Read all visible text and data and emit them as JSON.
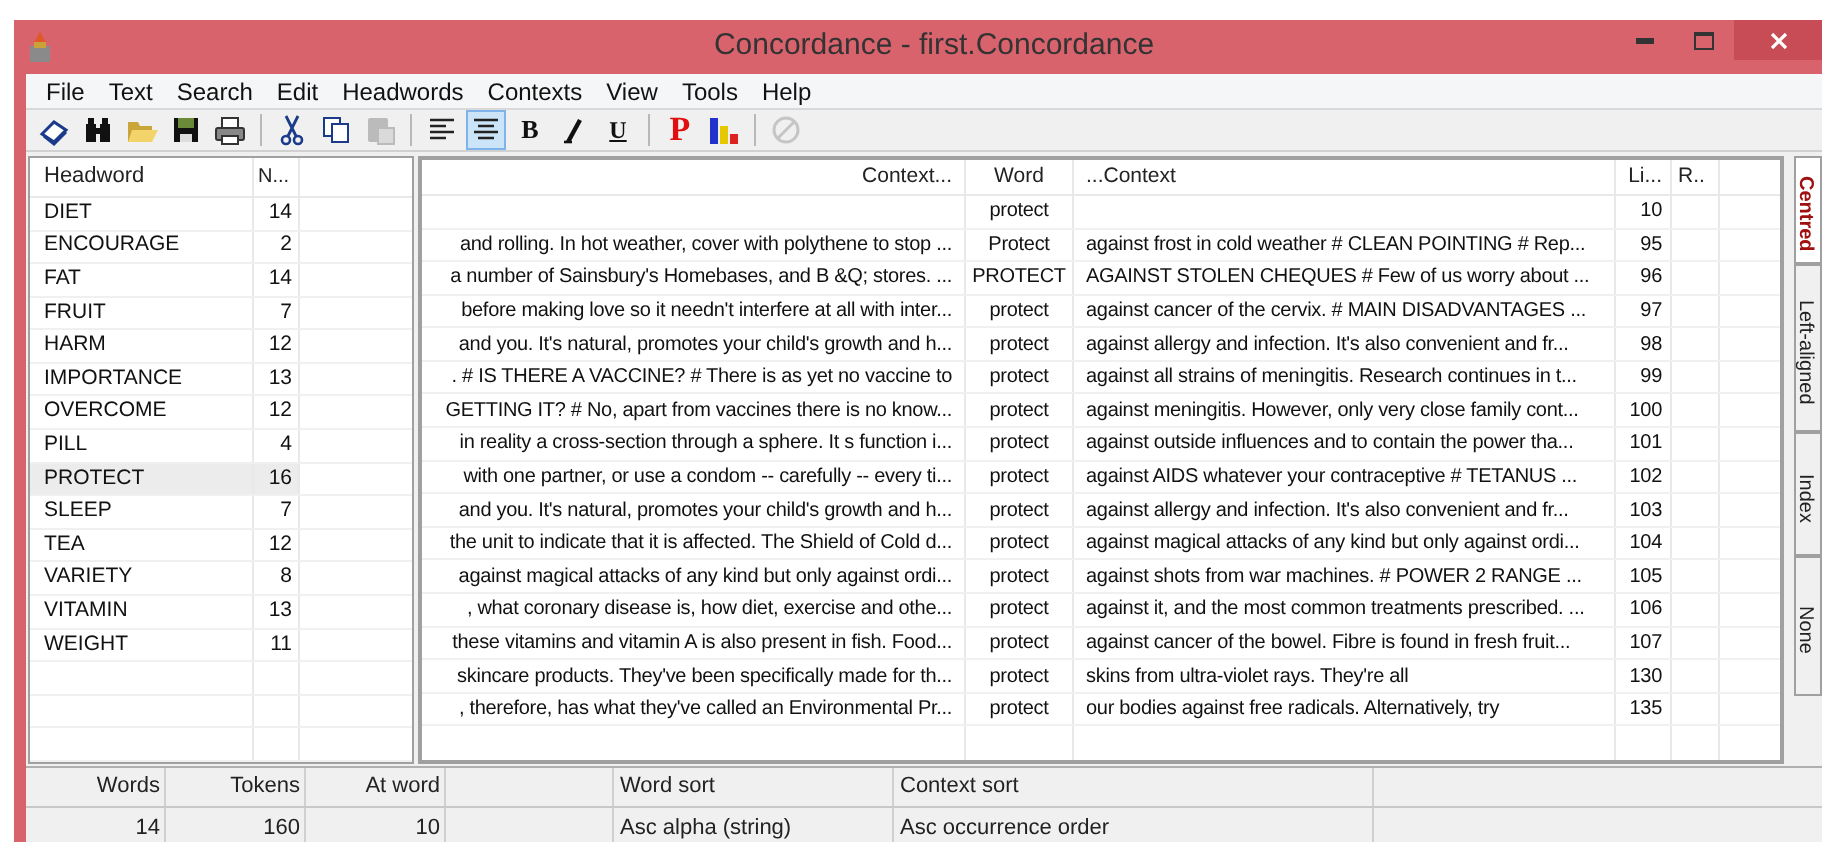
{
  "window": {
    "title": "Concordance - first.Concordance"
  },
  "menu": [
    "File",
    "Text",
    "Search",
    "Edit",
    "Headwords",
    "Contexts",
    "View",
    "Tools",
    "Help"
  ],
  "toolbar": [
    {
      "kind": "icon",
      "selected": false,
      "disabled": false
    },
    {
      "kind": "icon",
      "selected": false,
      "disabled": false
    },
    {
      "kind": "icon",
      "selected": false,
      "disabled": false
    },
    {
      "kind": "icon",
      "selected": false,
      "disabled": false
    },
    {
      "kind": "icon",
      "selected": false,
      "disabled": false
    },
    {
      "kind": "separator"
    },
    {
      "kind": "icon",
      "selected": false,
      "disabled": false
    },
    {
      "kind": "icon",
      "selected": false,
      "disabled": false
    },
    {
      "kind": "icon",
      "selected": false,
      "disabled": true
    },
    {
      "kind": "separator"
    },
    {
      "kind": "icon",
      "selected": false,
      "disabled": false
    },
    {
      "kind": "icon",
      "selected": true,
      "disabled": false
    },
    {
      "kind": "letter",
      "label": "B",
      "selected": false
    },
    {
      "kind": "icon",
      "selected": false,
      "disabled": false
    },
    {
      "kind": "letter",
      "label": "U",
      "selected": false
    },
    {
      "kind": "separator"
    },
    {
      "kind": "letter",
      "label": "P",
      "selected": false
    },
    {
      "kind": "icon",
      "selected": false,
      "disabled": false
    },
    {
      "kind": "separator"
    },
    {
      "kind": "icon",
      "selected": false,
      "disabled": true
    }
  ],
  "headwords": {
    "columns": [
      "Headword",
      "N..."
    ],
    "rows": [
      {
        "word": "DIET",
        "count": "14",
        "selected": false
      },
      {
        "word": "ENCOURAGE",
        "count": "2",
        "selected": false
      },
      {
        "word": "FAT",
        "count": "14",
        "selected": false
      },
      {
        "word": "FRUIT",
        "count": "7",
        "selected": false
      },
      {
        "word": "HARM",
        "count": "12",
        "selected": false
      },
      {
        "word": "IMPORTANCE",
        "count": "13",
        "selected": false
      },
      {
        "word": "OVERCOME",
        "count": "12",
        "selected": false
      },
      {
        "word": "PILL",
        "count": "4",
        "selected": false
      },
      {
        "word": "PROTECT",
        "count": "16",
        "selected": true
      },
      {
        "word": "SLEEP",
        "count": "7",
        "selected": false
      },
      {
        "word": "TEA",
        "count": "12",
        "selected": false
      },
      {
        "word": "VARIETY",
        "count": "8",
        "selected": false
      },
      {
        "word": "VITAMIN",
        "count": "13",
        "selected": false
      },
      {
        "word": "WEIGHT",
        "count": "11",
        "selected": false
      }
    ]
  },
  "contexts": {
    "columns": [
      "Context...",
      "Word",
      "...Context",
      "Li...",
      "R.."
    ],
    "rows": [
      {
        "left": "",
        "word": "protect",
        "right": "",
        "line": "10"
      },
      {
        "left": "and rolling. In hot weather, cover with polythene to stop ...",
        "word": "Protect",
        "right": "against frost in cold weather # CLEAN POINTING # Rep...",
        "line": "95"
      },
      {
        "left": "a number of Sainsbury's Homebases, and B &Q; stores. ...",
        "word": "PROTECT",
        "right": "AGAINST STOLEN CHEQUES # Few of us worry about ...",
        "line": "96"
      },
      {
        "left": " before making love so it needn't interfere at all with inter...",
        "word": "protect",
        "right": "against cancer of the cervix. # MAIN DISADVANTAGES ...",
        "line": "97"
      },
      {
        "left": "and you. It's natural, promotes your child's growth and h...",
        "word": "protect",
        "right": "against allergy and infection. It's also convenient and fr...",
        "line": "98"
      },
      {
        "left": " . # IS THERE A VACCINE? # There is as yet no vaccine to",
        "word": "protect",
        "right": "against all strains of meningitis. Research continues in t...",
        "line": "99"
      },
      {
        "left": "GETTING IT? # No, apart from vaccines there is no know...",
        "word": "protect",
        "right": "against meningitis. However, only very close family cont...",
        "line": "100"
      },
      {
        "left": "in reality a cross-section through a sphere. It s function i...",
        "word": "protect",
        "right": "against outside influences and to contain the power tha...",
        "line": "101"
      },
      {
        "left": "with one partner, or use a condom -- carefully -- every ti...",
        "word": "protect",
        "right": "against AIDS whatever your contraceptive # TETANUS ...",
        "line": "102"
      },
      {
        "left": "and you. It's natural, promotes your child's growth and h...",
        "word": "protect",
        "right": "against allergy and infection. It's also convenient and fr...",
        "line": "103"
      },
      {
        "left": "the unit to indicate that it is affected. The Shield of Cold d...",
        "word": "protect",
        "right": "against magical attacks of any kind but only against ordi...",
        "line": "104"
      },
      {
        "left": " against magical attacks of any kind but only against ordi...",
        "word": "protect",
        "right": "against shots from war machines. # POWER 2 RANGE ...",
        "line": "105"
      },
      {
        "left": " , what coronary disease is, how diet, exercise and othe...",
        "word": "protect",
        "right": "against it, and the most common treatments prescribed. ...",
        "line": "106"
      },
      {
        "left": "these vitamins and vitamin A is also present in fish. Food...",
        "word": "protect",
        "right": "against cancer of the bowel. Fibre is found in fresh fruit...",
        "line": "107"
      },
      {
        "left": "skincare products. They've been specifically made for th...",
        "word": "protect",
        "right": "skins from ultra-violet rays. They're all",
        "line": "130"
      },
      {
        "left": " , therefore, has what they've called an Environmental Pr...",
        "word": "protect",
        "right": "our bodies against free radicals. Alternatively, try",
        "line": "135"
      }
    ]
  },
  "side_tabs": [
    {
      "label": "Centred",
      "selected": true
    },
    {
      "label": "Left-aligned",
      "selected": false
    },
    {
      "label": "Index",
      "selected": false
    },
    {
      "label": "None",
      "selected": false
    }
  ],
  "status": [
    {
      "header": "Words",
      "value": "14"
    },
    {
      "header": "Tokens",
      "value": "160"
    },
    {
      "header": "At word",
      "value": "10"
    },
    {
      "header": "Word sort",
      "value": "Asc alpha (string)"
    },
    {
      "header": "Context sort",
      "value": "Asc occurrence order"
    }
  ]
}
